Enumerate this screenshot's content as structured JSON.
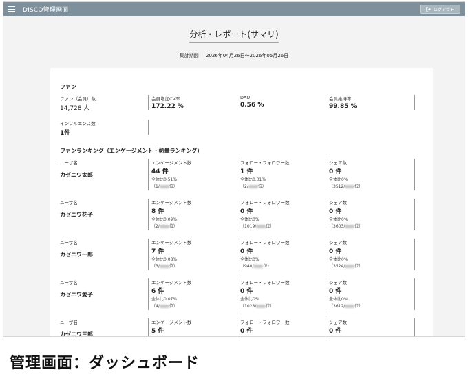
{
  "header": {
    "title": "DISCO管理画面",
    "logout_label": "ログアウト"
  },
  "page": {
    "title": "分析・レポート(サマリ)",
    "period_label": "集計期間",
    "period_value": "2026年04月26日〜2026年05月26日"
  },
  "fan": {
    "heading": "ファン",
    "kpis": [
      {
        "label": "ファン（会員）数",
        "value": "14,728 人"
      },
      {
        "label": "会員増加CV率",
        "value": "172.22 %"
      },
      {
        "label": "DAU",
        "value": "0.56 %"
      },
      {
        "label": "会員維持率",
        "value": "99.85 %"
      }
    ],
    "influencer": {
      "label": "インフルエンス数",
      "value": "1件"
    }
  },
  "ranking": {
    "heading": "ファンランキング（エンゲージメント・熱量ランキング）",
    "col_user": "ユーザ名",
    "col_engagement": "エンゲージメント数",
    "col_follow": "フォロー・フォロワー数",
    "col_share": "シェア数",
    "rows": [
      {
        "name": "カゼニワ太郎",
        "engagement": {
          "value": "44 件",
          "ratio": "全体比0.51%",
          "rank_a": "（1/",
          "rank_b": "位）"
        },
        "follow": {
          "value": "1 件",
          "ratio": "全体比0.01%",
          "rank_a": "（2/",
          "rank_b": "位）"
        },
        "share": {
          "value": "0 件",
          "ratio": "全体比0%",
          "rank_a": "（3512/",
          "rank_b": "位）"
        }
      },
      {
        "name": "カゼニワ花子",
        "engagement": {
          "value": "8 件",
          "ratio": "全体比0.09%",
          "rank_a": "（2/",
          "rank_b": "位）"
        },
        "follow": {
          "value": "0 件",
          "ratio": "全体比0%",
          "rank_a": "（1019/",
          "rank_b": "位）"
        },
        "share": {
          "value": "0 件",
          "ratio": "全体比0%",
          "rank_a": "（3603/",
          "rank_b": "位）"
        }
      },
      {
        "name": "カゼニワ一郎",
        "engagement": {
          "value": "7 件",
          "ratio": "全体比0.08%",
          "rank_a": "（3/",
          "rank_b": "位）"
        },
        "follow": {
          "value": "0 件",
          "ratio": "全体比0%",
          "rank_a": "（940/",
          "rank_b": "位）"
        },
        "share": {
          "value": "0 件",
          "ratio": "全体比0%",
          "rank_a": "（3524/",
          "rank_b": "位）"
        }
      },
      {
        "name": "カゼニワ愛子",
        "engagement": {
          "value": "6 件",
          "ratio": "全体比0.07%",
          "rank_a": "（4/",
          "rank_b": "位）"
        },
        "follow": {
          "value": "0 件",
          "ratio": "全体比0%",
          "rank_a": "（1028/",
          "rank_b": "位）"
        },
        "share": {
          "value": "0 件",
          "ratio": "全体比0%",
          "rank_a": "（3612/",
          "rank_b": "位）"
        }
      },
      {
        "name": "カゼニワ三郎",
        "engagement": {
          "value": "5 件"
        },
        "follow": {
          "value": "0 件"
        },
        "share": {
          "value": "0 件"
        }
      }
    ]
  },
  "caption": "管理画面：ダッシュボード"
}
